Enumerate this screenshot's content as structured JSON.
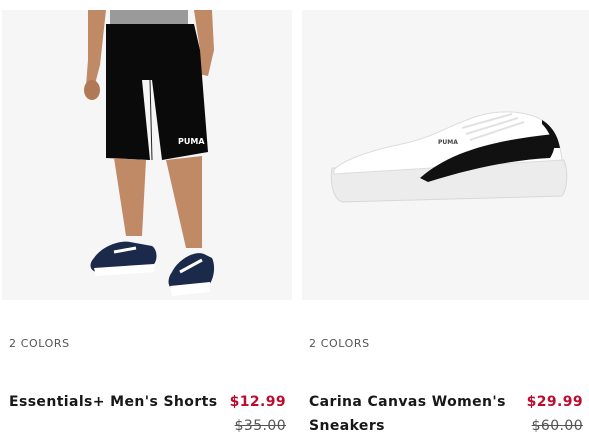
{
  "products": [
    {
      "image_alt": "Essentials+ Men's Shorts product image",
      "colors_label": "2 COLORS",
      "name": "Essentials+ Men's Shorts",
      "sale_price": "$12.99",
      "original_price": "$35.00"
    },
    {
      "image_alt": "Carina Canvas Women's Sneakers product image",
      "colors_label": "2 COLORS",
      "name": "Carina Canvas Women's Sneakers",
      "sale_price": "$29.99",
      "original_price": "$60.00"
    }
  ],
  "colors": {
    "sale": "#ba0c2f",
    "text": "#181818",
    "muted": "#555555",
    "image_bg": "#f6f6f6"
  }
}
